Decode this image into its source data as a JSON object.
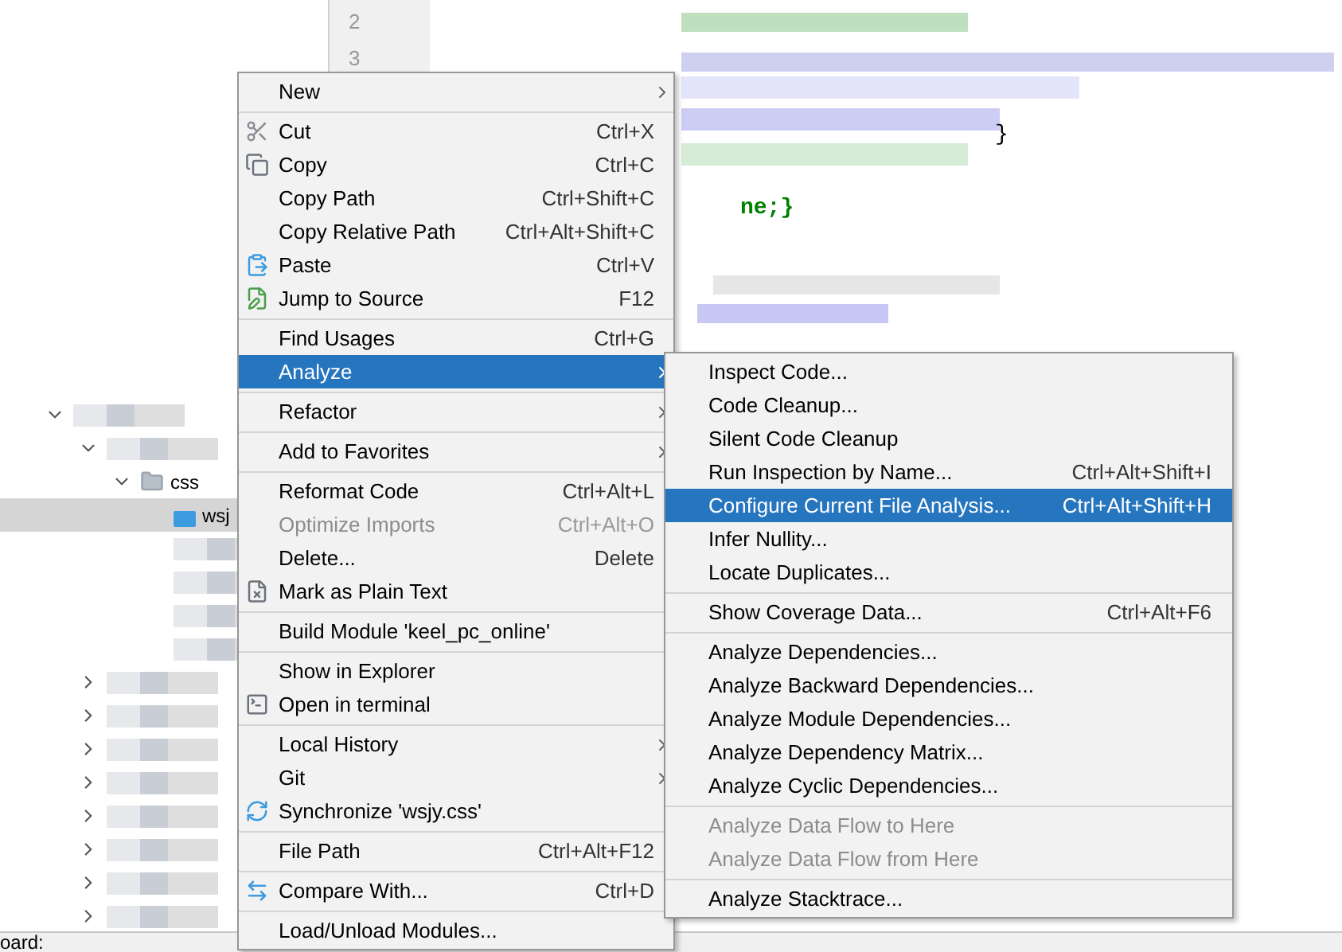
{
  "project_tree": [
    {
      "kind": "blurred",
      "expanded": true,
      "children": [
        {
          "kind": "blurred",
          "expanded": true,
          "children": [
            {
              "kind": "folder",
              "label": "css",
              "expanded": true,
              "children": [
                {
                  "kind": "file",
                  "label": "wsj",
                  "selected": true
                },
                {
                  "kind": "blurred"
                },
                {
                  "kind": "blurred"
                },
                {
                  "kind": "blurred"
                },
                {
                  "kind": "blurred"
                }
              ]
            }
          ]
        },
        {
          "kind": "blurred",
          "expanded": false
        },
        {
          "kind": "blurred",
          "expanded": false
        },
        {
          "kind": "blurred",
          "expanded": false
        },
        {
          "kind": "blurred",
          "expanded": false
        },
        {
          "kind": "blurred",
          "expanded": false
        },
        {
          "kind": "blurred",
          "expanded": false
        },
        {
          "kind": "blurred",
          "expanded": false
        },
        {
          "kind": "blurred",
          "expanded": false
        }
      ]
    }
  ],
  "status_bar": {
    "text": "oard:"
  },
  "editor": {
    "line_numbers": [
      "2",
      "3"
    ],
    "fragments": [
      "}",
      "ne;}"
    ]
  },
  "context_menu": {
    "items": [
      {
        "kind": "item",
        "label": "New",
        "submenu": true,
        "selected": false,
        "disabled": false
      },
      {
        "kind": "separator"
      },
      {
        "kind": "item",
        "label": "Cut",
        "shortcut": "Ctrl+X",
        "selected": false,
        "disabled": false
      },
      {
        "kind": "item",
        "label": "Copy",
        "shortcut": "Ctrl+C",
        "selected": false,
        "disabled": false
      },
      {
        "kind": "item",
        "label": "Copy Path",
        "shortcut": "Ctrl+Shift+C",
        "selected": false,
        "disabled": false
      },
      {
        "kind": "item",
        "label": "Copy Relative Path",
        "shortcut": "Ctrl+Alt+Shift+C",
        "selected": false,
        "disabled": false
      },
      {
        "kind": "item",
        "label": "Paste",
        "shortcut": "Ctrl+V",
        "selected": false,
        "disabled": false
      },
      {
        "kind": "item",
        "label": "Jump to Source",
        "shortcut": "F12",
        "selected": false,
        "disabled": false
      },
      {
        "kind": "separator"
      },
      {
        "kind": "item",
        "label": "Find Usages",
        "shortcut": "Ctrl+G",
        "selected": false,
        "disabled": false
      },
      {
        "kind": "item",
        "label": "Analyze",
        "submenu": true,
        "selected": true,
        "disabled": false
      },
      {
        "kind": "separator"
      },
      {
        "kind": "item",
        "label": "Refactor",
        "submenu": true,
        "selected": false,
        "disabled": false
      },
      {
        "kind": "separator"
      },
      {
        "kind": "item",
        "label": "Add to Favorites",
        "submenu": true,
        "selected": false,
        "disabled": false
      },
      {
        "kind": "separator"
      },
      {
        "kind": "item",
        "label": "Reformat Code",
        "shortcut": "Ctrl+Alt+L",
        "selected": false,
        "disabled": false
      },
      {
        "kind": "item",
        "label": "Optimize Imports",
        "shortcut": "Ctrl+Alt+O",
        "selected": false,
        "disabled": true
      },
      {
        "kind": "item",
        "label": "Delete...",
        "shortcut": "Delete",
        "selected": false,
        "disabled": false
      },
      {
        "kind": "item",
        "label": "Mark as Plain Text",
        "selected": false,
        "disabled": false
      },
      {
        "kind": "separator"
      },
      {
        "kind": "item",
        "label": "Build Module 'keel_pc_online'",
        "selected": false,
        "disabled": false
      },
      {
        "kind": "separator"
      },
      {
        "kind": "item",
        "label": "Show in Explorer",
        "selected": false,
        "disabled": false
      },
      {
        "kind": "item",
        "label": "Open in terminal",
        "selected": false,
        "disabled": false
      },
      {
        "kind": "separator"
      },
      {
        "kind": "item",
        "label": "Local History",
        "submenu": true,
        "selected": false,
        "disabled": false
      },
      {
        "kind": "item",
        "label": "Git",
        "submenu": true,
        "selected": false,
        "disabled": false
      },
      {
        "kind": "item",
        "label": "Synchronize 'wsjy.css'",
        "selected": false,
        "disabled": false
      },
      {
        "kind": "separator"
      },
      {
        "kind": "item",
        "label": "File Path",
        "shortcut": "Ctrl+Alt+F12",
        "selected": false,
        "disabled": false
      },
      {
        "kind": "separator"
      },
      {
        "kind": "item",
        "label": "Compare With...",
        "shortcut": "Ctrl+D",
        "selected": false,
        "disabled": false
      },
      {
        "kind": "separator"
      },
      {
        "kind": "item",
        "label": "Load/Unload Modules...",
        "selected": false,
        "disabled": false
      }
    ]
  },
  "analyze_submenu": {
    "items": [
      {
        "kind": "item",
        "label": "Inspect Code...",
        "selected": false,
        "disabled": false
      },
      {
        "kind": "item",
        "label": "Code Cleanup...",
        "selected": false,
        "disabled": false
      },
      {
        "kind": "item",
        "label": "Silent Code Cleanup",
        "selected": false,
        "disabled": false
      },
      {
        "kind": "item",
        "label": "Run Inspection by Name...",
        "shortcut": "Ctrl+Alt+Shift+I",
        "selected": false,
        "disabled": false
      },
      {
        "kind": "item",
        "label": "Configure Current File Analysis...",
        "shortcut": "Ctrl+Alt+Shift+H",
        "selected": true,
        "disabled": false
      },
      {
        "kind": "item",
        "label": "Infer Nullity...",
        "selected": false,
        "disabled": false
      },
      {
        "kind": "item",
        "label": "Locate Duplicates...",
        "selected": false,
        "disabled": false
      },
      {
        "kind": "separator"
      },
      {
        "kind": "item",
        "label": "Show Coverage Data...",
        "shortcut": "Ctrl+Alt+F6",
        "selected": false,
        "disabled": false
      },
      {
        "kind": "separator"
      },
      {
        "kind": "item",
        "label": "Analyze Dependencies...",
        "selected": false,
        "disabled": false
      },
      {
        "kind": "item",
        "label": "Analyze Backward Dependencies...",
        "selected": false,
        "disabled": false
      },
      {
        "kind": "item",
        "label": "Analyze Module Dependencies...",
        "selected": false,
        "disabled": false
      },
      {
        "kind": "item",
        "label": "Analyze Dependency Matrix...",
        "selected": false,
        "disabled": false
      },
      {
        "kind": "item",
        "label": "Analyze Cyclic Dependencies...",
        "selected": false,
        "disabled": false
      },
      {
        "kind": "separator"
      },
      {
        "kind": "item",
        "label": "Analyze Data Flow to Here",
        "selected": false,
        "disabled": true
      },
      {
        "kind": "item",
        "label": "Analyze Data Flow from Here",
        "selected": false,
        "disabled": true
      },
      {
        "kind": "separator"
      },
      {
        "kind": "item",
        "label": "Analyze Stacktrace...",
        "selected": false,
        "disabled": false
      }
    ]
  }
}
